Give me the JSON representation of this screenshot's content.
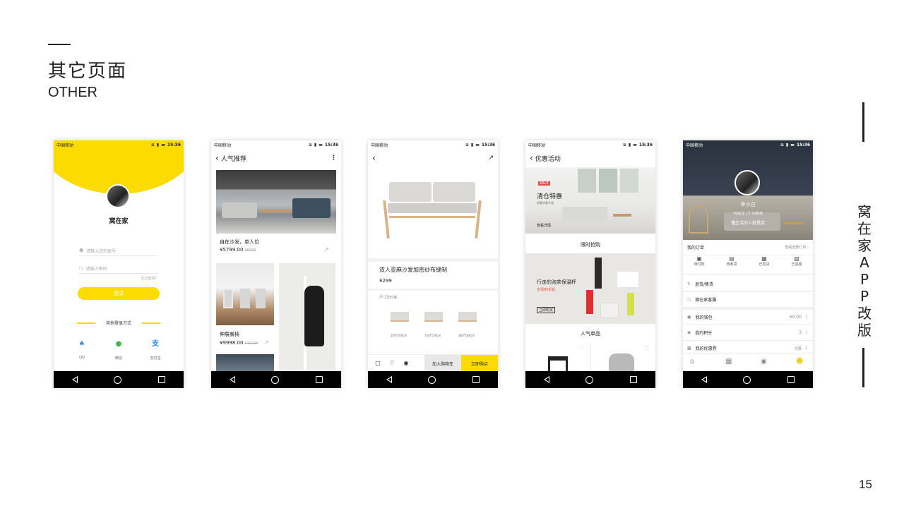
{
  "header": {
    "title": "其它页面",
    "subtitle": "OTHER"
  },
  "side": {
    "title": "窝在家APP改版",
    "page_number": "15"
  },
  "status": {
    "carrier": "中国移动",
    "time": "15:36"
  },
  "login": {
    "app_name": "窝在家",
    "account_placeholder": "请输入您的账号",
    "password_placeholder": "请输入密码",
    "forgot": "忘记密码?",
    "login_button": "登录",
    "other_methods": "其他登录方式",
    "socials": [
      {
        "label": "QQ",
        "icon": "qq-icon",
        "color": "#3a8ee6"
      },
      {
        "label": "微信",
        "icon": "wechat-icon",
        "color": "#46b34b"
      },
      {
        "label": "支付宝",
        "icon": "alipay-icon",
        "color": "#2a8ae6"
      }
    ]
  },
  "popular": {
    "title": "人气推荐",
    "items": [
      {
        "name": "自在沙发，单人位",
        "price": "¥5799.00",
        "old_price": "¥8799"
      },
      {
        "name": "伸展餐椅",
        "price": "¥9998.00",
        "old_price": "¥10233"
      }
    ]
  },
  "product": {
    "name": "双人亚麻沙发加密纱布缝制",
    "price": "¥299",
    "size_section": "尺寸及价格",
    "sizes": [
      "100*100cm",
      "150*150cm",
      "180*180cm"
    ],
    "add_to_cart": "加入购物车",
    "buy_now": "立即购买"
  },
  "promo": {
    "title": "优惠活动",
    "banner_sale": "SALE",
    "banner_title": "清仓特惠",
    "banner_sub": "新春特惠专场",
    "banner_link": "查看详情",
    "flash": "限时抢购",
    "flash_title": "行走的泡茶保温杯",
    "flash_sub": "全场85折起",
    "flash_btn": "立即购买",
    "popular": "人气单品"
  },
  "profile": {
    "username": "李小白",
    "stats": "78关注 | 2.1K粉丝",
    "motto": "懂生活的人就是我",
    "orders_title": "我的订单",
    "orders_all": "查看全部订单",
    "order_states": [
      "待付款",
      "待收货",
      "已发货",
      "已完成"
    ],
    "returns": "退货/售货",
    "service": "窝在家客服",
    "wallet": "我的钱包",
    "wallet_value": "¥0.00",
    "points": "我的积分",
    "points_value": "3",
    "coupons": "我的优惠券",
    "coupons_value": "0张"
  }
}
